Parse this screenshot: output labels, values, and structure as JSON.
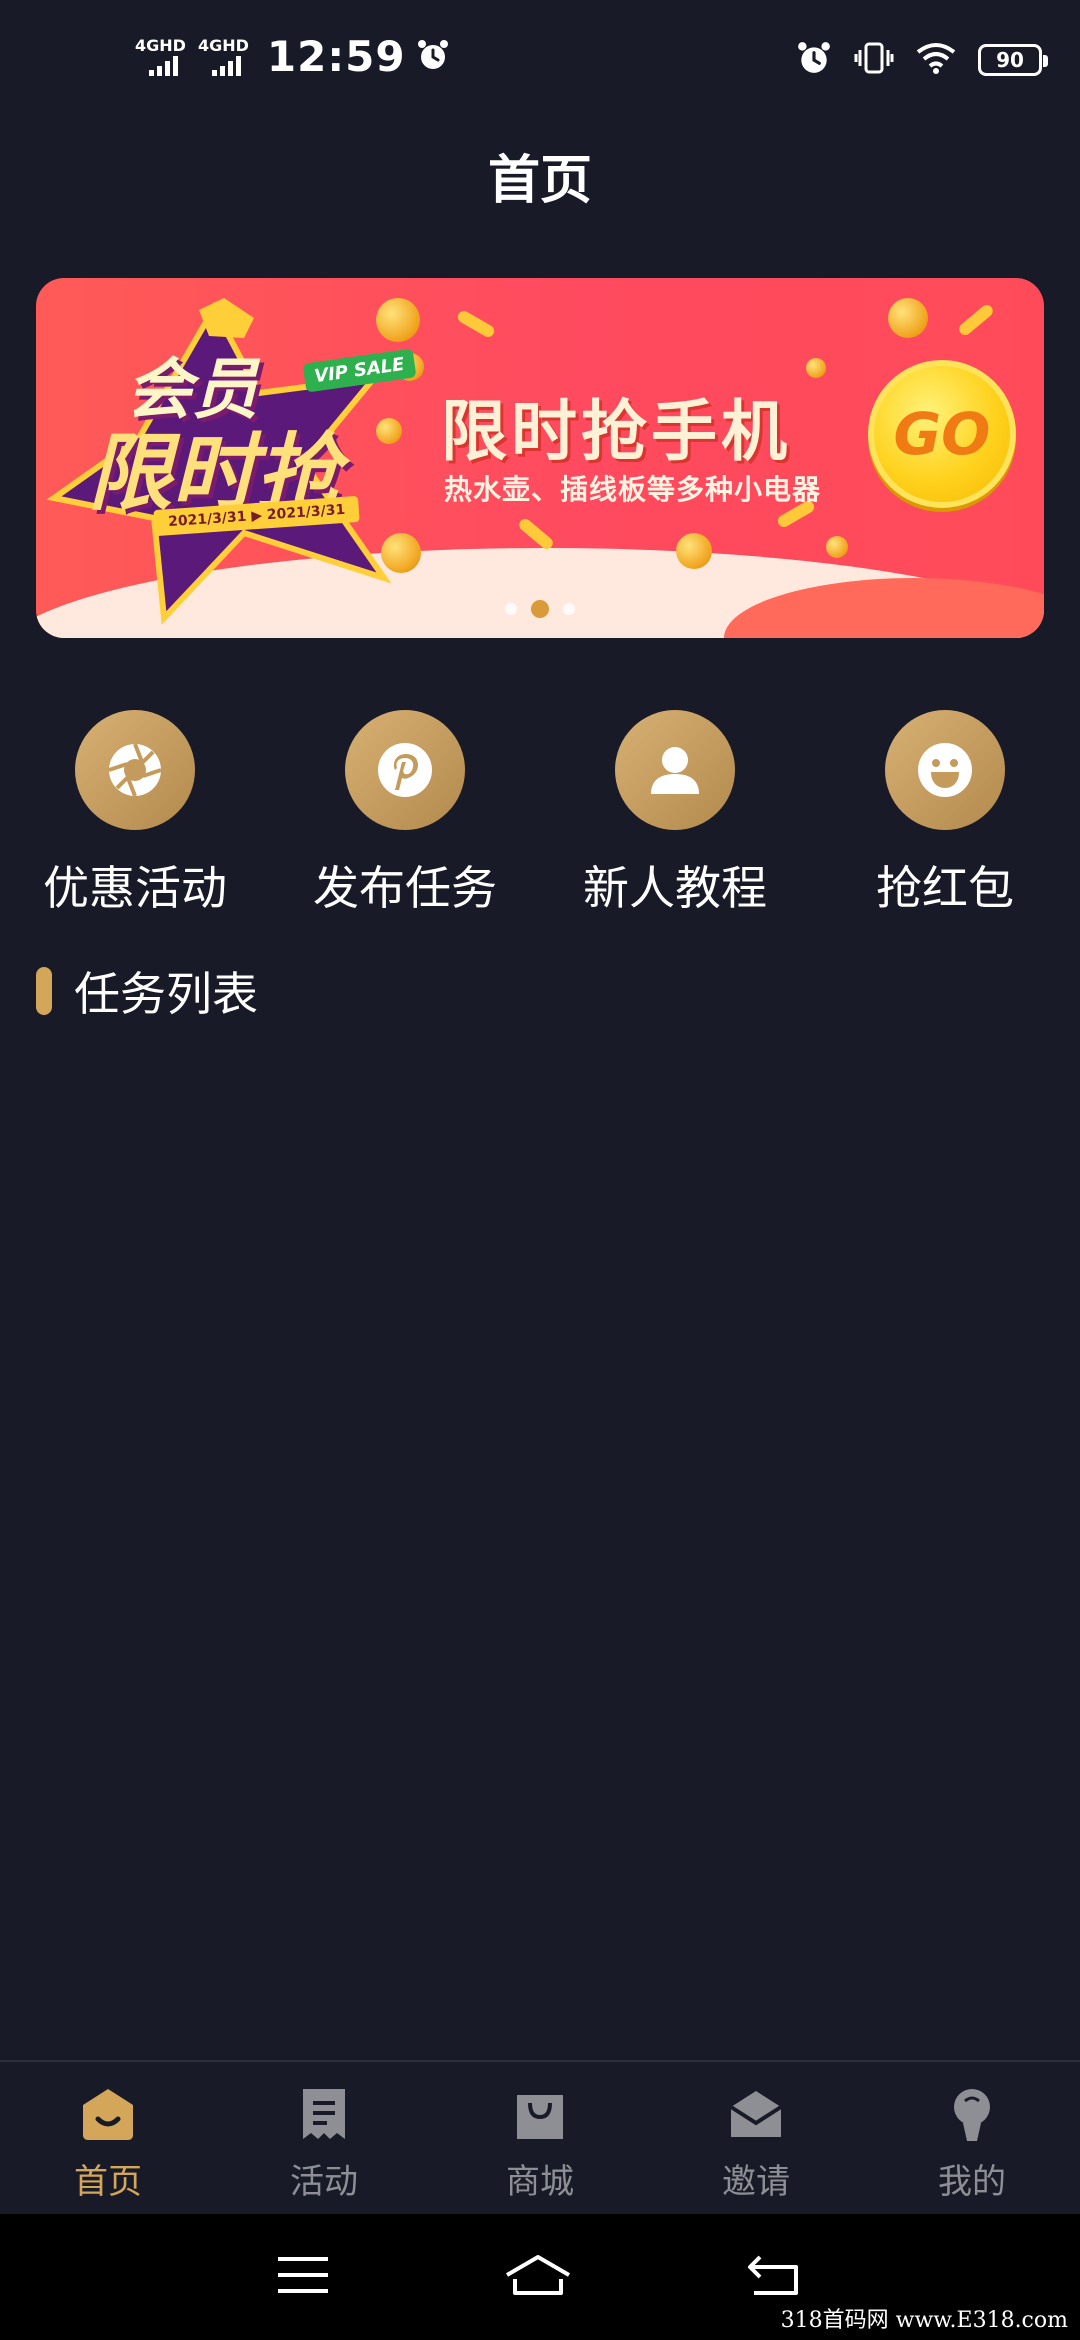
{
  "status_bar": {
    "sim1_label": "4GHD",
    "sim2_label": "4GHD",
    "time": "12:59",
    "battery": "90",
    "icons": [
      "signal-icon",
      "alarm-icon",
      "vibrate-icon",
      "wifi-icon",
      "battery-icon"
    ]
  },
  "header": {
    "title": "首页"
  },
  "banner": {
    "badge_line1": "会员",
    "badge_line2": "限时抢",
    "vip_tag": "VIP SALE",
    "dates": "2021/3/31 ▶ 2021/3/31",
    "headline": "限时抢手机",
    "subline": "热水壶、插线板等多种小电器",
    "go_label": "GO",
    "page_indicator": {
      "count": 3,
      "active": 2
    },
    "colors": {
      "background": "#ff4f5c",
      "accent": "#ffd21e"
    }
  },
  "quick_menu": [
    {
      "label": "优惠活动",
      "icon": "aperture-icon"
    },
    {
      "label": "发布任务",
      "icon": "pin-icon"
    },
    {
      "label": "新人教程",
      "icon": "user-icon"
    },
    {
      "label": "抢红包",
      "icon": "smile-icon"
    }
  ],
  "section": {
    "title": "任务列表"
  },
  "tab_bar": {
    "active_index": 0,
    "tabs": [
      {
        "label": "首页",
        "icon": "home-icon"
      },
      {
        "label": "活动",
        "icon": "receipt-icon"
      },
      {
        "label": "商城",
        "icon": "shopping-bag-icon"
      },
      {
        "label": "邀请",
        "icon": "mail-icon"
      },
      {
        "label": "我的",
        "icon": "profile-icon"
      }
    ]
  },
  "system_nav": {
    "icons": [
      "menu-icon",
      "home-icon",
      "back-icon"
    ]
  },
  "watermark": "318首码网 www.E318.com",
  "theme": {
    "background": "#181b27",
    "accent": "#d4a65a",
    "inactive": "#8e8f95"
  }
}
